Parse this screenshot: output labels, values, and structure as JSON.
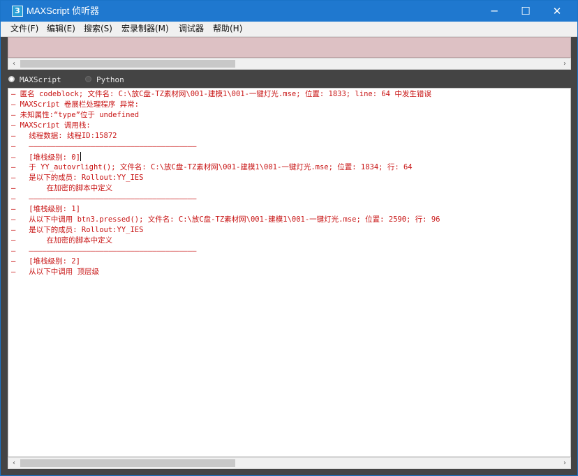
{
  "window": {
    "title": "MAXScript 侦听器",
    "icon_glyph": "3",
    "controls": {
      "minimize": "─",
      "maximize": "☐",
      "close": "✕"
    }
  },
  "menu": [
    "文件(F)",
    "编辑(E)",
    "搜索(S)",
    "宏录制器(M)",
    "调试器",
    "帮助(H)"
  ],
  "scroll_arrows": {
    "left": "‹",
    "right": "›"
  },
  "language": {
    "options": [
      "MAXScript",
      "Python"
    ],
    "selected": "MAXScript"
  },
  "output": {
    "lines": [
      "— 匿名 codeblock; 文件名: C:\\放C盘-TZ素材网\\001-建模1\\001-一键灯光.mse; 位置: 1833; line: 64 中发生错误",
      "— MAXScript 卷展栏处理程序 异常:",
      "— 未知属性:“type”位于 undefined",
      "— MAXScript 调用栈:",
      "—   线程数据: 线程ID:15872",
      "—   ——————————————————————————————————————",
      "—   [堆栈级别: 0]",
      "—   于 YY_autovrlight(); 文件名: C:\\放C盘-TZ素材网\\001-建模1\\001-一键灯光.mse; 位置: 1834; 行: 64",
      "—   是以下的成员: Rollout:YY_IES",
      "—       在加密的脚本中定义",
      "—   ——————————————————————————————————————",
      "—   [堆栈级别: 1]",
      "—   从以下中调用 btn3.pressed(); 文件名: C:\\放C盘-TZ素材网\\001-建模1\\001-一键灯光.mse; 位置: 2590; 行: 96",
      "—   是以下的成员: Rollout:YY_IES",
      "—       在加密的脚本中定义",
      "—   ——————————————————————————————————————",
      "—   [堆栈级别: 2]",
      "—   从以下中调用 顶层级"
    ],
    "text_color": "#c81414",
    "caret_line": 6
  },
  "colors": {
    "titlebar": "#1f78cf",
    "input_bg": "#ddc1c4",
    "chrome_bg": "#444444"
  }
}
